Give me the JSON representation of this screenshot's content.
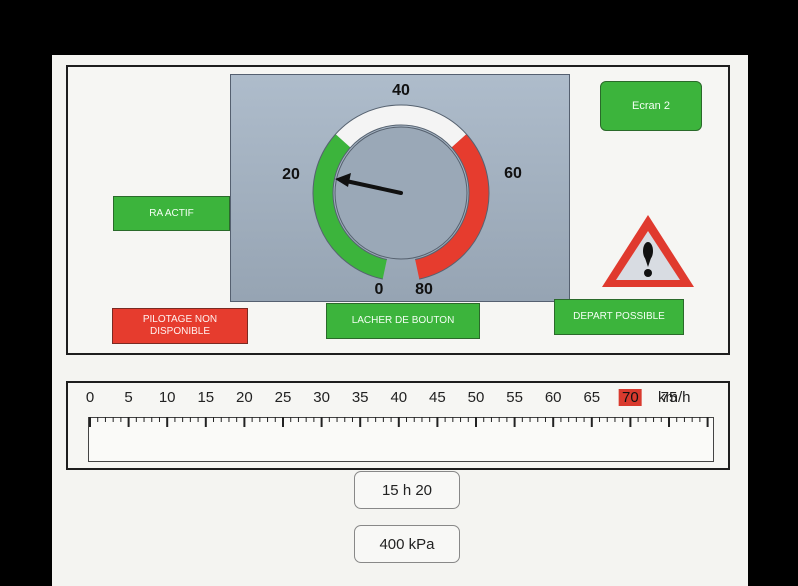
{
  "gauge": {
    "labels": [
      "0",
      "20",
      "40",
      "60",
      "80"
    ],
    "needle_value": 20,
    "colors": {
      "green": "#3cb43c",
      "white": "#f4f4f4",
      "red": "#e63c2e",
      "needle": "#111111"
    }
  },
  "buttons": {
    "ecran": "Ecran 2",
    "ra_actif": "RA ACTIF",
    "pilotage": "PILOTAGE NON\nDISPONIBLE",
    "lacher": "LACHER DE BOUTON",
    "depart": "DEPART POSSIBLE"
  },
  "speed_scale": {
    "labels": [
      "0",
      "5",
      "10",
      "15",
      "20",
      "25",
      "30",
      "35",
      "40",
      "45",
      "50",
      "55",
      "60",
      "65",
      "70",
      "75"
    ],
    "unit": "km/h",
    "highlighted": "70",
    "highlight_color": "#d93a2e"
  },
  "readouts": {
    "time": "15 h 20",
    "pressure": "400 kPa"
  },
  "warning": {
    "icon": "warning-triangle-icon",
    "colors": {
      "border": "#e03a2e",
      "symbol": "#111111"
    }
  }
}
